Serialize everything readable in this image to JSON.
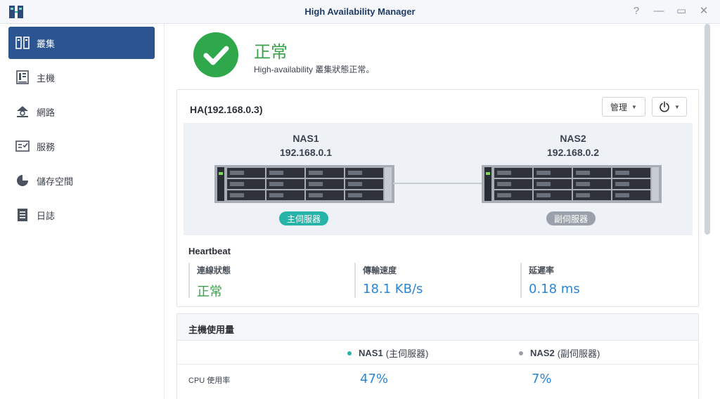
{
  "window": {
    "title": "High Availability Manager",
    "controls": [
      "?",
      "—",
      "▭",
      "✕"
    ]
  },
  "sidebar": {
    "items": [
      {
        "label": "叢集",
        "icon": "cluster-icon",
        "active": true
      },
      {
        "label": "主機",
        "icon": "host-icon",
        "active": false
      },
      {
        "label": "網路",
        "icon": "network-icon",
        "active": false
      },
      {
        "label": "服務",
        "icon": "service-icon",
        "active": false
      },
      {
        "label": "儲存空間",
        "icon": "storage-icon",
        "active": false
      },
      {
        "label": "日誌",
        "icon": "log-icon",
        "active": false
      }
    ]
  },
  "status": {
    "title": "正常",
    "description": "High-availability 叢集狀態正常。",
    "icon": "check-circle-icon",
    "color": "#2ea84a"
  },
  "cluster": {
    "title": "HA(192.168.0.3)",
    "manage_label": "管理",
    "power_icon": "power-icon",
    "nas1": {
      "name": "NAS1",
      "ip": "192.168.0.1",
      "role": "主伺服器"
    },
    "nas2": {
      "name": "NAS2",
      "ip": "192.168.0.2",
      "role": "副伺服器"
    }
  },
  "heartbeat": {
    "title": "Heartbeat",
    "columns": [
      {
        "label": "連線狀態",
        "value": "正常"
      },
      {
        "label": "傳輸速度",
        "value": "18.1 KB/s"
      },
      {
        "label": "延遲率",
        "value": "0.18 ms"
      }
    ]
  },
  "usage": {
    "title": "主機使用量",
    "col1_name": "NAS1",
    "col1_role": "(主伺服器)",
    "col2_name": "NAS2",
    "col2_role": "(副伺服器)",
    "rows": [
      {
        "label": "CPU 使用率",
        "nas1": "47%",
        "nas2": "7%"
      }
    ]
  },
  "colors": {
    "accent": "#2c5490",
    "ok": "#3aa14a",
    "value_blue": "#2a86d6",
    "primary_badge": "#26b4a8",
    "secondary_badge": "#9aa1ab"
  }
}
